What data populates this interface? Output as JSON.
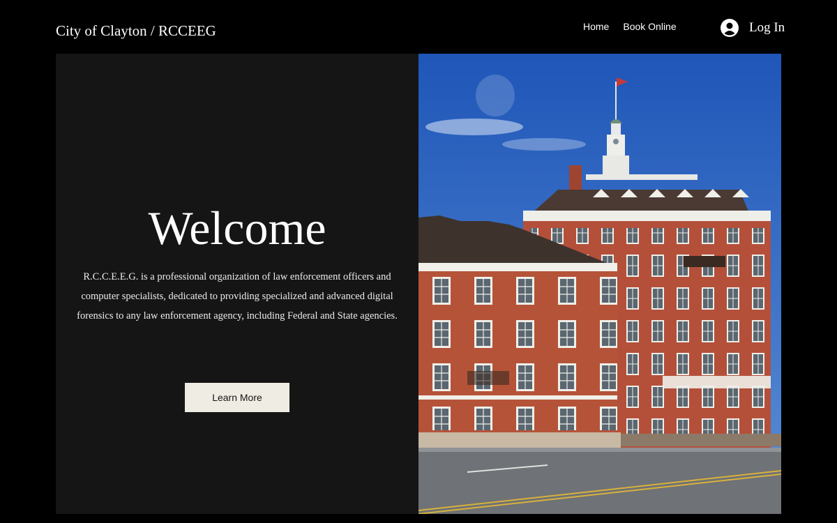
{
  "header": {
    "site_title": "City of Clayton / RCCEEG",
    "nav": [
      {
        "label": "Home"
      },
      {
        "label": "Book Online"
      }
    ],
    "login_label": "Log In"
  },
  "hero": {
    "title": "Welcome",
    "description": "R.C.C.E.E.G. is a professional organization of law enforcement officers and computer specialists, dedicated to providing specialized and advanced digital forensics to any law enforcement agency, including Federal and State agencies.",
    "button_label": "Learn More"
  },
  "colors": {
    "page_background": "#000000",
    "panel_background": "#151515",
    "button_background": "#efece4",
    "button_text": "#151515",
    "sky": "#2d62bd",
    "brick": "#b4503a"
  },
  "icons": {
    "account": "user-avatar-icon"
  }
}
